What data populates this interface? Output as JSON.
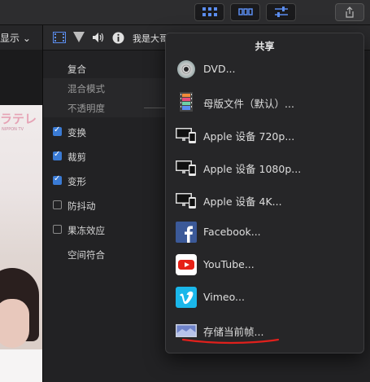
{
  "left_panel": {
    "view_menu_label": "显示 ⌄"
  },
  "inspector": {
    "clip_title": "我是大哥",
    "rows": [
      {
        "label": "复合",
        "type": "header"
      },
      {
        "label": "混合模式",
        "type": "sub"
      },
      {
        "label": "不透明度",
        "type": "sub"
      },
      {
        "label": "变换",
        "type": "checkbox",
        "checked": true
      },
      {
        "label": "裁剪",
        "type": "checkbox",
        "checked": true
      },
      {
        "label": "变形",
        "type": "checkbox",
        "checked": true
      },
      {
        "label": "防抖动",
        "type": "checkbox",
        "checked": false
      },
      {
        "label": "果冻效应",
        "type": "checkbox",
        "checked": false
      },
      {
        "label": "空间符合",
        "type": "plain"
      }
    ]
  },
  "share_menu": {
    "title": "共享",
    "items": [
      {
        "label": "DVD...",
        "icon": "dvd-icon"
      },
      {
        "label": "母版文件（默认）...",
        "icon": "master-file-icon"
      },
      {
        "label": "Apple 设备 720p...",
        "icon": "apple-devices-icon"
      },
      {
        "label": "Apple 设备 1080p...",
        "icon": "apple-devices-icon"
      },
      {
        "label": "Apple 设备 4K...",
        "icon": "apple-devices-icon"
      },
      {
        "label": "Facebook...",
        "icon": "facebook-icon"
      },
      {
        "label": "YouTube...",
        "icon": "youtube-icon"
      },
      {
        "label": "Vimeo...",
        "icon": "vimeo-icon"
      },
      {
        "label": "存储当前帧...",
        "icon": "save-frame-icon"
      }
    ]
  },
  "colors": {
    "accent": "#3a7bd5",
    "annotation": "#e0201c"
  }
}
